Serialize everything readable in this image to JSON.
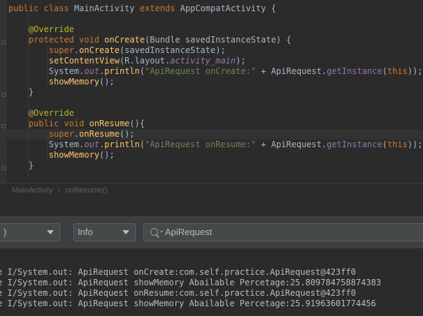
{
  "editor": {
    "lines": [
      {
        "parts": [
          [
            "kw",
            "public "
          ],
          [
            "kw",
            "class "
          ],
          [
            "cls",
            "MainActivity "
          ],
          [
            "kw",
            "extends "
          ],
          [
            "cls",
            "AppCompatActivity {"
          ]
        ]
      },
      {
        "parts": []
      },
      {
        "parts": [
          [
            "ann",
            "    @Override"
          ]
        ]
      },
      {
        "parts": [
          [
            "kw",
            "    protected "
          ],
          [
            "kw",
            "void "
          ],
          [
            "fn",
            "onCreate"
          ],
          [
            "cls",
            "(Bundle savedInstanceState) {"
          ]
        ]
      },
      {
        "parts": [
          [
            "kw",
            "        super"
          ],
          [
            "cls",
            "."
          ],
          [
            "fn",
            "onCreate"
          ],
          [
            "cls",
            "(savedInstanceState);"
          ]
        ]
      },
      {
        "parts": [
          [
            "fn",
            "        setContentView"
          ],
          [
            "cls",
            "(R.layout."
          ],
          [
            "italic-field",
            "activity_main"
          ],
          [
            "cls",
            ");"
          ]
        ]
      },
      {
        "parts": [
          [
            "cls",
            "        System."
          ],
          [
            "italic-field",
            "out"
          ],
          [
            "cls",
            "."
          ],
          [
            "fn",
            "println"
          ],
          [
            "cls",
            "("
          ],
          [
            "str",
            "\"ApiRequest onCreate:\""
          ],
          [
            "cls",
            " + ApiRequest."
          ],
          [
            "greyfn",
            "getInstance"
          ],
          [
            "cls",
            "("
          ],
          [
            "kw",
            "this"
          ],
          [
            "cls",
            "));"
          ]
        ]
      },
      {
        "parts": [
          [
            "fn",
            "        showMemory"
          ],
          [
            "cls",
            "();"
          ]
        ]
      },
      {
        "parts": [
          [
            "cls",
            "    }"
          ]
        ]
      },
      {
        "parts": []
      },
      {
        "parts": [
          [
            "ann",
            "    @Override"
          ]
        ]
      },
      {
        "parts": [
          [
            "kw",
            "    public "
          ],
          [
            "kw",
            "void "
          ],
          [
            "fn",
            "onResume"
          ],
          [
            "cls",
            "(){"
          ]
        ]
      },
      {
        "parts": [
          [
            "kw",
            "        super"
          ],
          [
            "cls",
            "."
          ],
          [
            "fn",
            "onResume"
          ],
          [
            "cls",
            "();"
          ]
        ]
      },
      {
        "parts": [
          [
            "cls",
            "        System."
          ],
          [
            "italic-field",
            "out"
          ],
          [
            "cls",
            "."
          ],
          [
            "fn",
            "println"
          ],
          [
            "cls",
            "("
          ],
          [
            "str",
            "\"ApiRequest onResume:\""
          ],
          [
            "cls",
            " + ApiRequest."
          ],
          [
            "greyfn",
            "getInstance"
          ],
          [
            "cls",
            "("
          ],
          [
            "kw",
            "this"
          ],
          [
            "cls",
            "));"
          ]
        ]
      },
      {
        "parts": [
          [
            "fn",
            "        showMemory"
          ],
          [
            "cls",
            "();"
          ]
        ]
      },
      {
        "parts": [
          [
            "cls",
            "    }"
          ]
        ]
      }
    ]
  },
  "breadcrumb": {
    "class_name": "MainActivity",
    "separator": "›",
    "method_name": "onResume()"
  },
  "toolbar": {
    "device_select_value": ")",
    "level_select_value": "Info",
    "search_value": "ApiRequest"
  },
  "logcat": {
    "lines": [
      "e I/System.out: ApiRequest onCreate:com.self.practice.ApiRequest@423ff0",
      "e I/System.out: ApiRequest showMemory Abailable Percetage:25.809784758874383",
      "e I/System.out: ApiRequest onResume:com.self.practice.ApiRequest@423ff0",
      "e I/System.out: ApiRequest showMemory Abailable Percetage:25.91963601774456"
    ]
  },
  "colors": {
    "keyword": "#cc7832",
    "method": "#ffc66d",
    "string": "#6a8759",
    "annotation": "#bbb529",
    "field": "#9876aa",
    "background": "#2b2b2b"
  }
}
